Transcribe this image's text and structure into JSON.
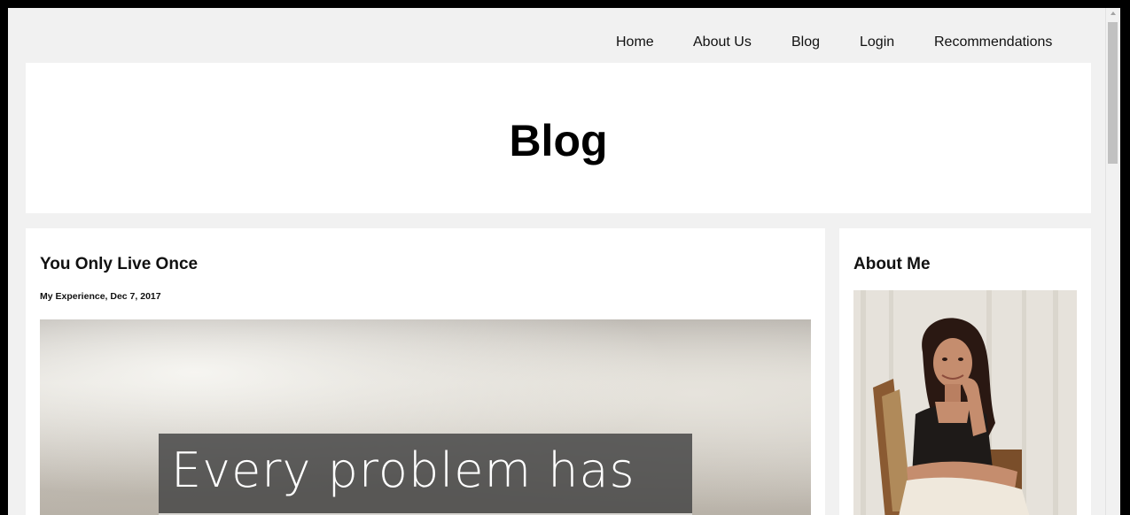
{
  "nav": {
    "items": [
      {
        "label": "Home"
      },
      {
        "label": "About Us"
      },
      {
        "label": "Blog"
      },
      {
        "label": "Login"
      },
      {
        "label": "Recommendations"
      }
    ]
  },
  "header": {
    "title": "Blog"
  },
  "post": {
    "title": "You Only Live Once",
    "meta": "My Experience, Dec 7, 2017",
    "image_caption": "Every problem has"
  },
  "sidebar": {
    "title": "About Me",
    "photo_icon": "woman-portrait-icon"
  },
  "colors": {
    "page_bg": "#f1f1f1",
    "card_bg": "#ffffff",
    "text": "#111111"
  }
}
